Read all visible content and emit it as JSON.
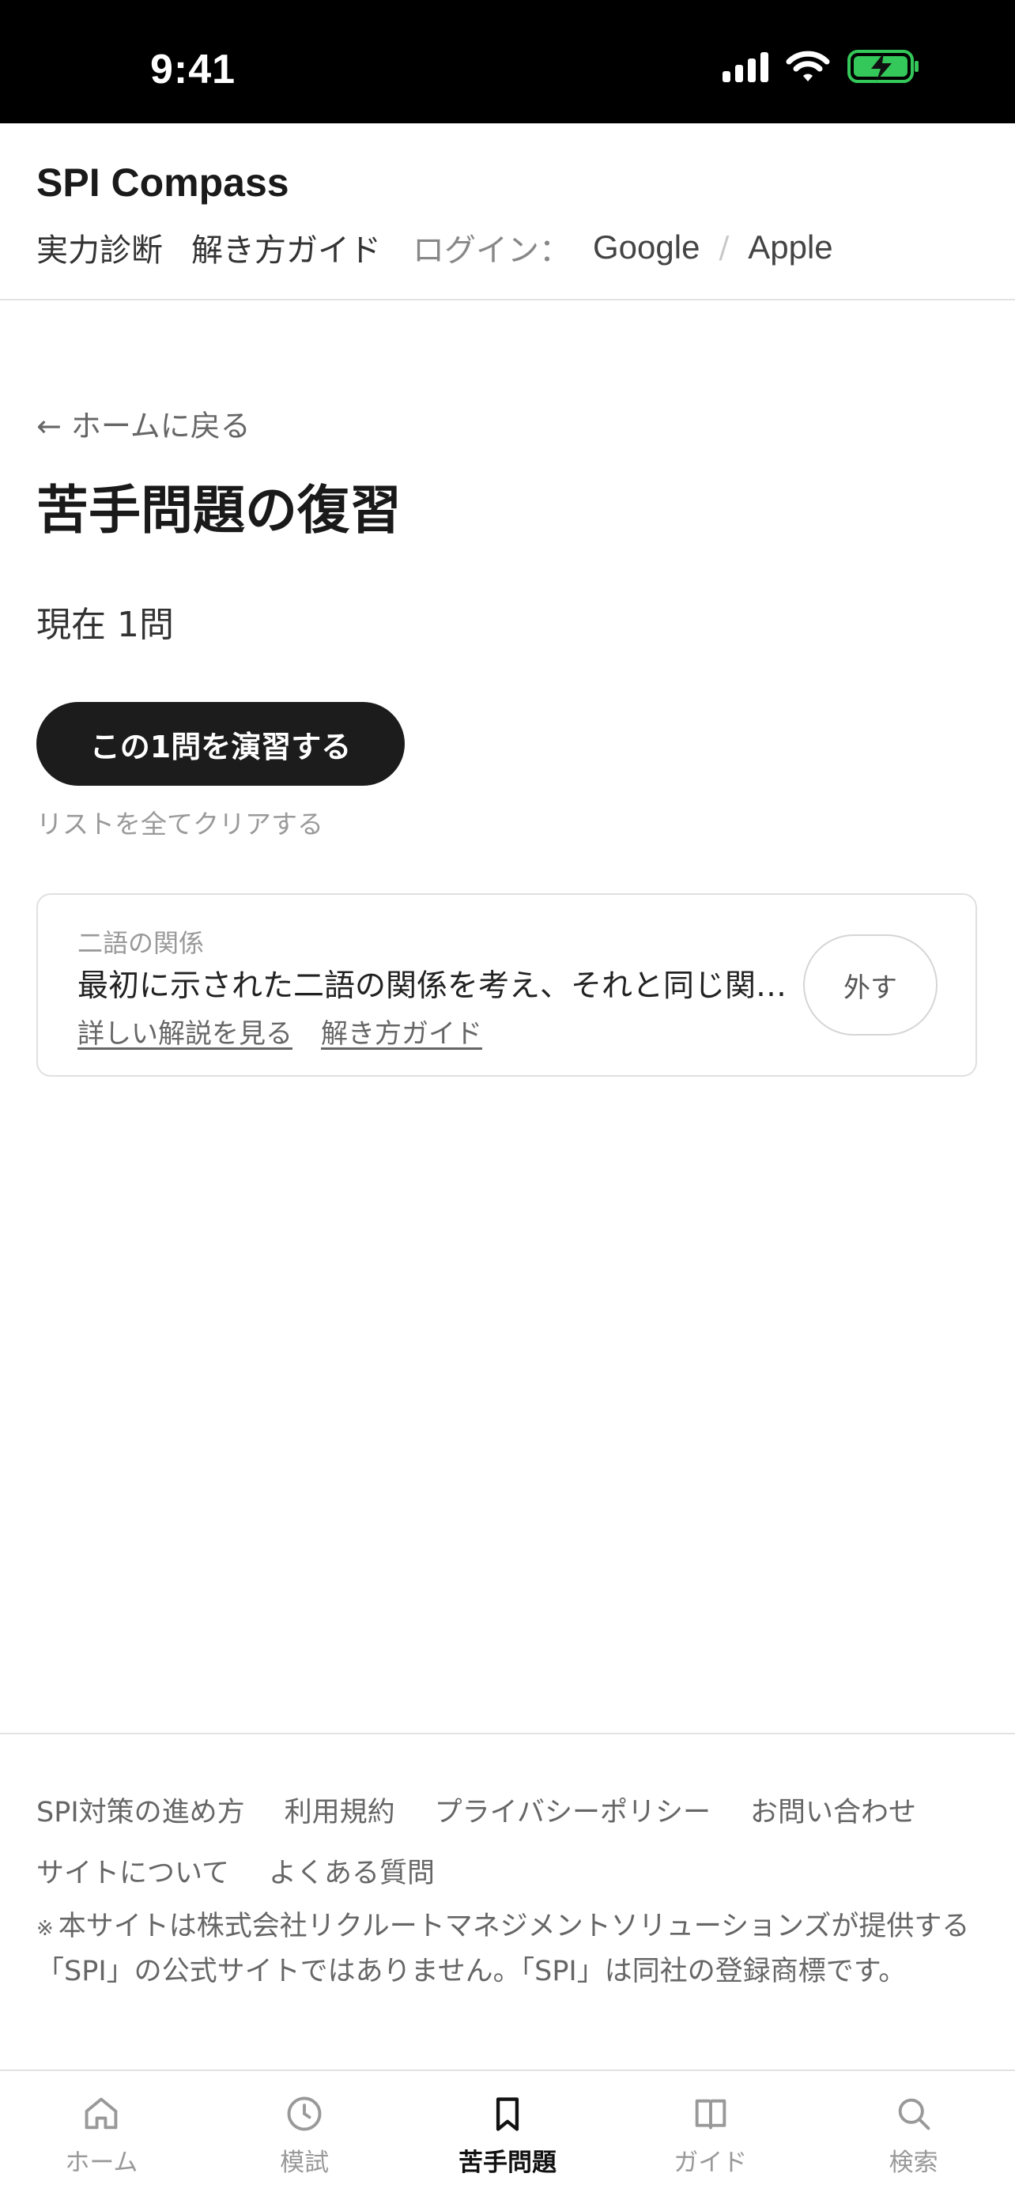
{
  "status_bar": {
    "time": "9:41",
    "battery_color": "#34c759"
  },
  "header": {
    "brand": "SPI Compass",
    "nav": [
      "実力診断",
      "解き方ガイド"
    ],
    "login_label": "ログイン：",
    "login_providers": [
      "Google",
      "Apple"
    ],
    "login_separator": "/"
  },
  "main": {
    "back_link": "← ホームに戻る",
    "title": "苦手問題の復習",
    "count_text": "現在 1問",
    "practice_button": "この1問を演習する",
    "clear_link": "リストを全てクリアする",
    "items": [
      {
        "category": "二語の関係",
        "text": "最初に示された二語の関係を考え、それと同じ関係のものを選びなさい",
        "links": [
          "詳しい解説を見る",
          "解き方ガイド"
        ],
        "remove_label": "外す"
      }
    ]
  },
  "footer": {
    "links": [
      "SPI対策の進め方",
      "利用規約",
      "プライバシーポリシー",
      "お問い合わせ",
      "サイトについて",
      "よくある質問"
    ],
    "disclaimer_mark": "※",
    "disclaimer": "本サイトは株式会社リクルートマネジメントソリューションズが提供する「SPI」の公式サイトではありません。「SPI」は同社の登録商標です。"
  },
  "tab_bar": {
    "tabs": [
      {
        "label": "ホーム",
        "icon": "home-icon"
      },
      {
        "label": "模試",
        "icon": "clock-icon"
      },
      {
        "label": "苦手問題",
        "icon": "bookmark-icon",
        "active": true
      },
      {
        "label": "ガイド",
        "icon": "book-icon"
      },
      {
        "label": "検索",
        "icon": "search-icon"
      }
    ]
  }
}
